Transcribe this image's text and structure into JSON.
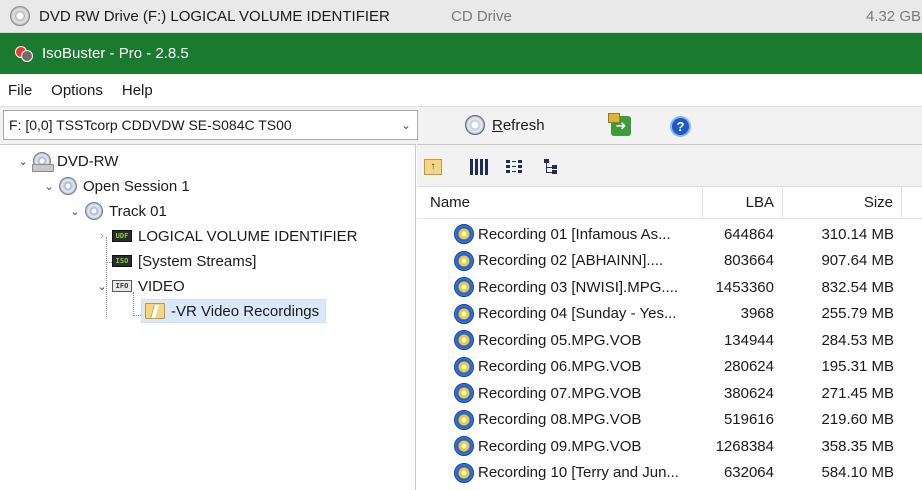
{
  "drive_bar": {
    "title": "DVD RW Drive (F:) LOGICAL VOLUME IDENTIFIER",
    "type": "CD Drive",
    "size": "4.32 GB"
  },
  "window": {
    "title": "IsoBuster - Pro - 2.8.5",
    "title_bar_color": "#1a7a2f"
  },
  "menu": {
    "items": [
      "File",
      "Options",
      "Help"
    ]
  },
  "toolbar": {
    "drive_select_value": "F: [0,0]  TSSTcorp  CDDVDW SE-S084C   TS00",
    "refresh_label_first": "R",
    "refresh_label_rest": "efresh",
    "export_icon": "export-icon",
    "help_icon": "help-icon",
    "help_glyph": "?"
  },
  "tree": {
    "root": "DVD-RW",
    "session": "Open Session 1",
    "track": "Track 01",
    "fs_udf": "LOGICAL VOLUME IDENTIFIER",
    "fs_udf_badge": "UDF",
    "system_streams": "[System Streams]",
    "system_streams_badge": "ISO",
    "video": "VIDEO",
    "video_badge": "IFO",
    "selected_folder": "-VR Video Recordings"
  },
  "file_list": {
    "toolbar_icons": [
      "folder-up-icon",
      "large-icons-view-icon",
      "details-view-icon",
      "tree-view-icon"
    ],
    "up_glyph": "↑",
    "columns": {
      "name": "Name",
      "lba": "LBA",
      "size": "Size"
    },
    "rows": [
      {
        "name": "Recording 01 [Infamous As...",
        "lba": "644864",
        "size": "310.14 MB"
      },
      {
        "name": "Recording 02 [ABHAINN]....",
        "lba": "803664",
        "size": "907.64 MB"
      },
      {
        "name": "Recording 03 [NWISI].MPG....",
        "lba": "1453360",
        "size": "832.54 MB"
      },
      {
        "name": "Recording 04 [Sunday - Yes...",
        "lba": "3968",
        "size": "255.79 MB"
      },
      {
        "name": "Recording 05.MPG.VOB",
        "lba": "134944",
        "size": "284.53 MB"
      },
      {
        "name": "Recording 06.MPG.VOB",
        "lba": "280624",
        "size": "195.31 MB"
      },
      {
        "name": "Recording 07.MPG.VOB",
        "lba": "380624",
        "size": "271.45 MB"
      },
      {
        "name": "Recording 08.MPG.VOB",
        "lba": "519616",
        "size": "219.60 MB"
      },
      {
        "name": "Recording 09.MPG.VOB",
        "lba": "1268384",
        "size": "358.35 MB"
      },
      {
        "name": "Recording 10 [Terry and Jun...",
        "lba": "632064",
        "size": "584.10 MB"
      }
    ]
  }
}
